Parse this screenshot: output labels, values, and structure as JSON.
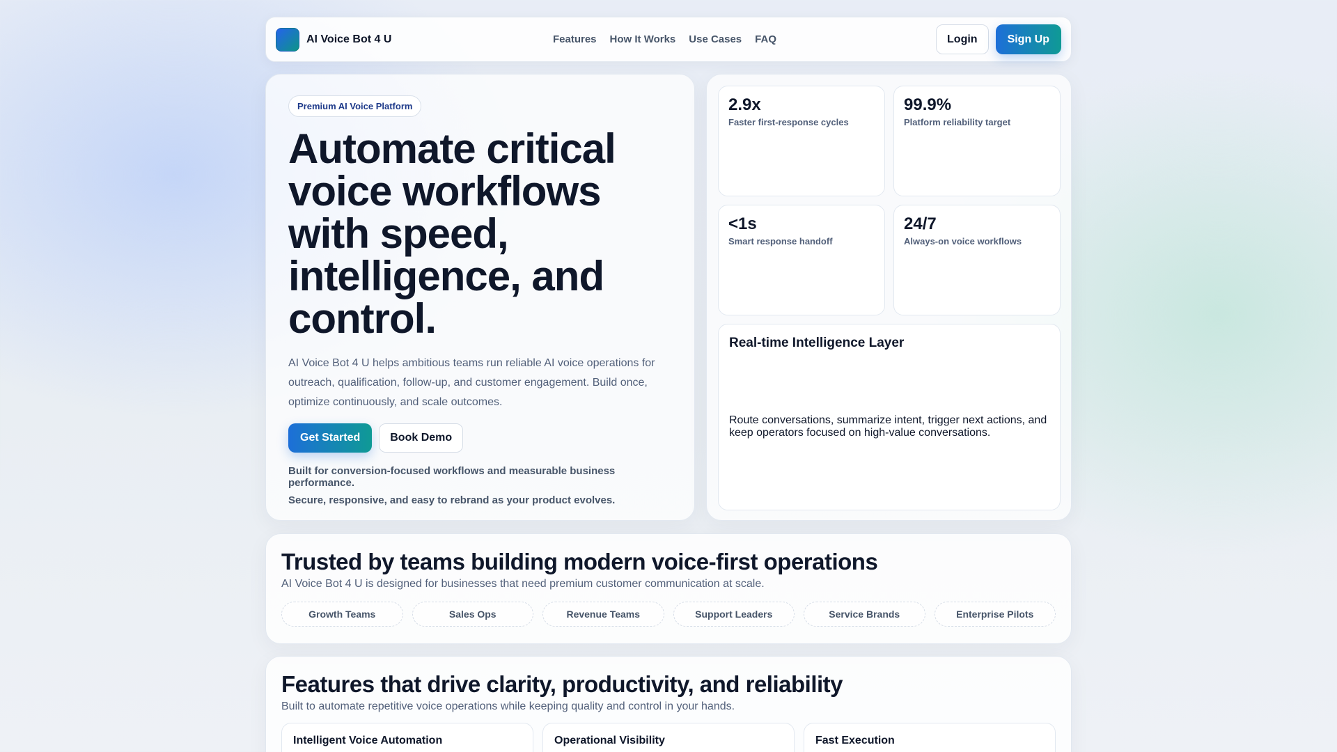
{
  "nav": {
    "brand": "AI Voice Bot 4 U",
    "links": [
      "Features",
      "How It Works",
      "Use Cases",
      "FAQ"
    ],
    "login": "Login",
    "signup": "Sign Up"
  },
  "hero": {
    "badge": "Premium AI Voice Platform",
    "title_lines": [
      "Automate critical",
      "voice workflows",
      "with speed,",
      "intelligence, and",
      "control."
    ],
    "description": "AI Voice Bot 4 U helps ambitious teams run reliable AI voice operations for outreach, qualification, follow-up, and customer engagement. Build once, optimize continuously, and scale outcomes.",
    "cta_primary": "Get Started",
    "cta_secondary": "Book Demo",
    "note1": "Built for conversion-focused workflows and measurable business performance.",
    "note2": "Secure, responsive, and easy to rebrand as your product evolves."
  },
  "stats": [
    {
      "value": "2.9x",
      "label": "Faster first-response cycles"
    },
    {
      "value": "99.9%",
      "label": "Platform reliability target"
    },
    {
      "value": "<1s",
      "label": "Smart response handoff"
    },
    {
      "value": "24/7",
      "label": "Always-on voice workflows"
    }
  ],
  "intel": {
    "title": "Real-time Intelligence Layer",
    "body": "Route conversations, summarize intent, trigger next actions, and keep operators focused on high-value conversations."
  },
  "trusted": {
    "title": "Trusted by teams building modern voice-first operations",
    "subtitle": "AI Voice Bot 4 U is designed for businesses that need premium customer communication at scale.",
    "chips": [
      "Growth Teams",
      "Sales Ops",
      "Revenue Teams",
      "Support Leaders",
      "Service Brands",
      "Enterprise Pilots"
    ]
  },
  "features": {
    "title": "Features that drive clarity, productivity, and reliability",
    "subtitle": "Built to automate repetitive voice operations while keeping quality and control in your hands.",
    "cards": [
      "Intelligent Voice Automation",
      "Operational Visibility",
      "Fast Execution"
    ]
  }
}
